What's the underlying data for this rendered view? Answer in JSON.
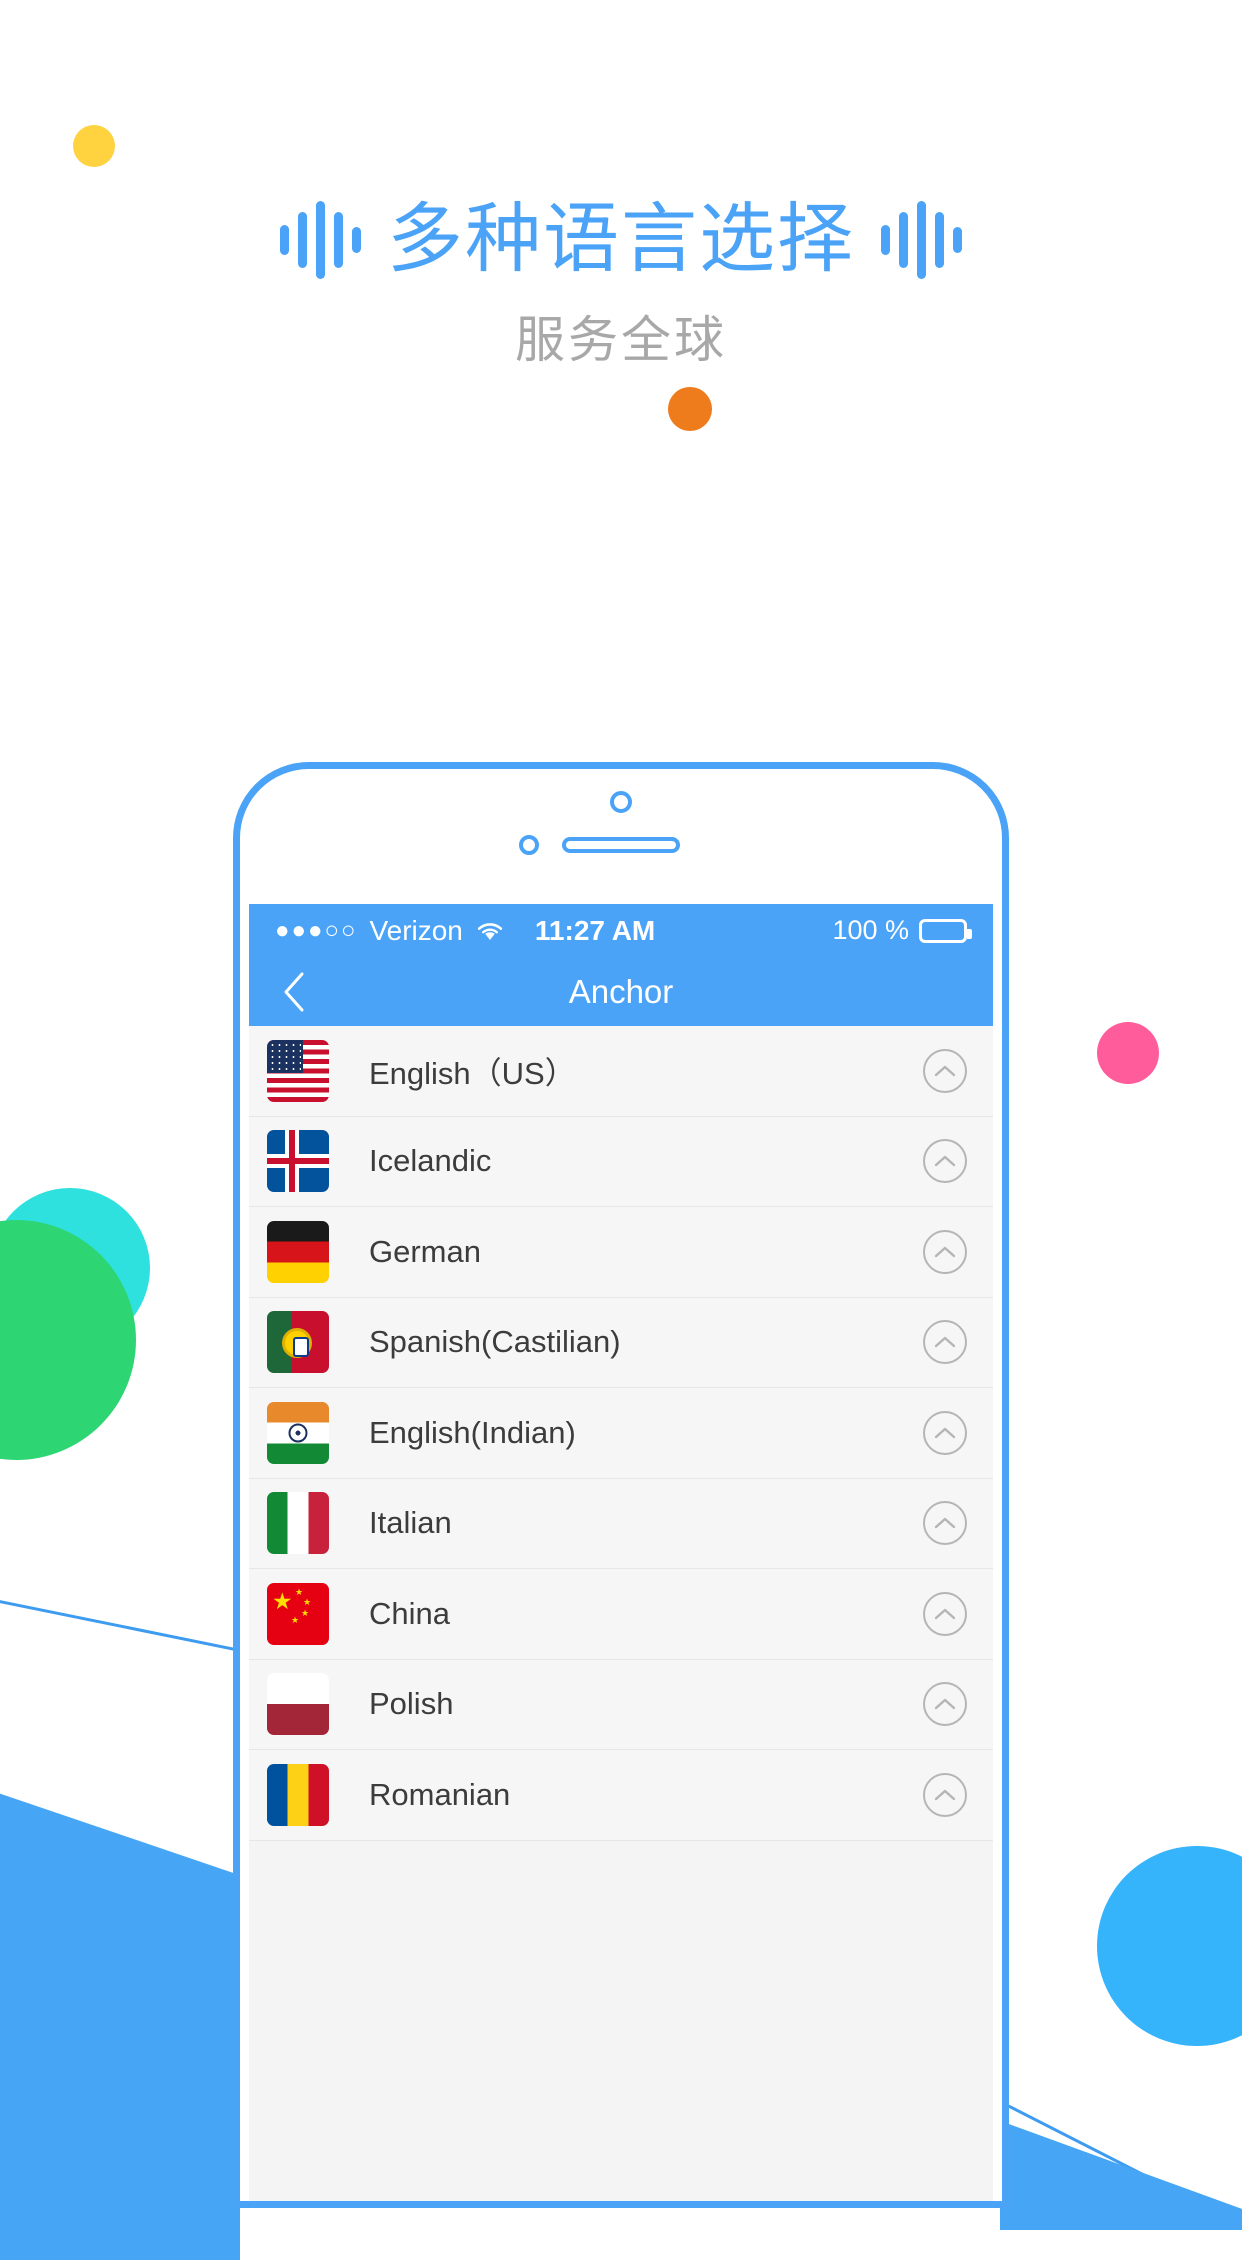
{
  "promo": {
    "headline": "多种语言选择",
    "subheadline": "服务全球",
    "accent_color": "#4AA3F7",
    "subheadline_color": "#A8A8A8"
  },
  "decor": {
    "dot_yellow": "#FFD23F",
    "dot_orange": "#EE7B1C",
    "dot_pink": "#FF5C9B",
    "dot_cyan": "#2EE0DE",
    "dot_green": "#2ED573",
    "dot_blue": "#35B4FB",
    "wedge_blue": "#46A6F5"
  },
  "phone": {
    "status_bar": {
      "signal_dots": "●●●○○",
      "carrier": "Verizon",
      "wifi_icon": "wifi-icon",
      "time": "11:27 AM",
      "battery_percent": "100 %",
      "battery_icon": "battery-full-icon",
      "background": "#4AA3F7"
    },
    "nav_bar": {
      "back_icon": "chevron-left-icon",
      "title": "Anchor"
    },
    "language_list": {
      "row_accessory_icon": "chevron-up-circle-icon",
      "items": [
        {
          "label": "English（US）",
          "flag": "flag-us"
        },
        {
          "label": "Icelandic",
          "flag": "flag-iceland"
        },
        {
          "label": "German",
          "flag": "flag-germany"
        },
        {
          "label": "Spanish(Castilian)",
          "flag": "flag-portugal"
        },
        {
          "label": "English(Indian)",
          "flag": "flag-india"
        },
        {
          "label": "Italian",
          "flag": "flag-italy"
        },
        {
          "label": "China",
          "flag": "flag-china"
        },
        {
          "label": "Polish",
          "flag": "flag-poland"
        },
        {
          "label": "Romanian",
          "flag": "flag-romania"
        }
      ]
    }
  }
}
